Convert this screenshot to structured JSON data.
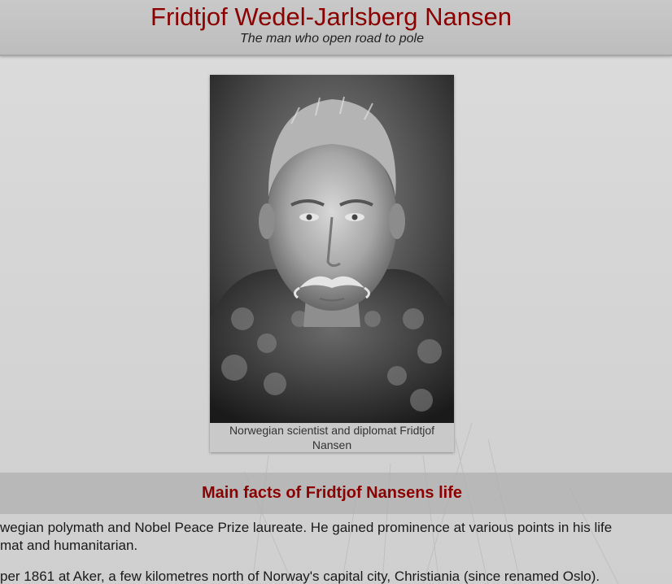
{
  "header": {
    "title": "Fridtjof Wedel-Jarlsberg Nansen",
    "subtitle": "The man who open road to pole"
  },
  "figure": {
    "caption": "Norwegian scientist and diplomat Fridtjof Nansen",
    "image": "portrait-photo"
  },
  "section": {
    "title": "Main facts of Fridtjof Nansens life",
    "paragraphs": [
      "wegian polymath and Nobel Peace Prize laureate. He gained prominence at various points in his life",
      "mat and humanitarian.",
      "per 1861 at Aker, a few kilometres north of Norway's capital city, Christiania (since renamed Oslo)."
    ]
  },
  "colors": {
    "title": "#8b0000",
    "header_bg": "#c4c4c4",
    "page_bg": "#d6d6d6"
  }
}
